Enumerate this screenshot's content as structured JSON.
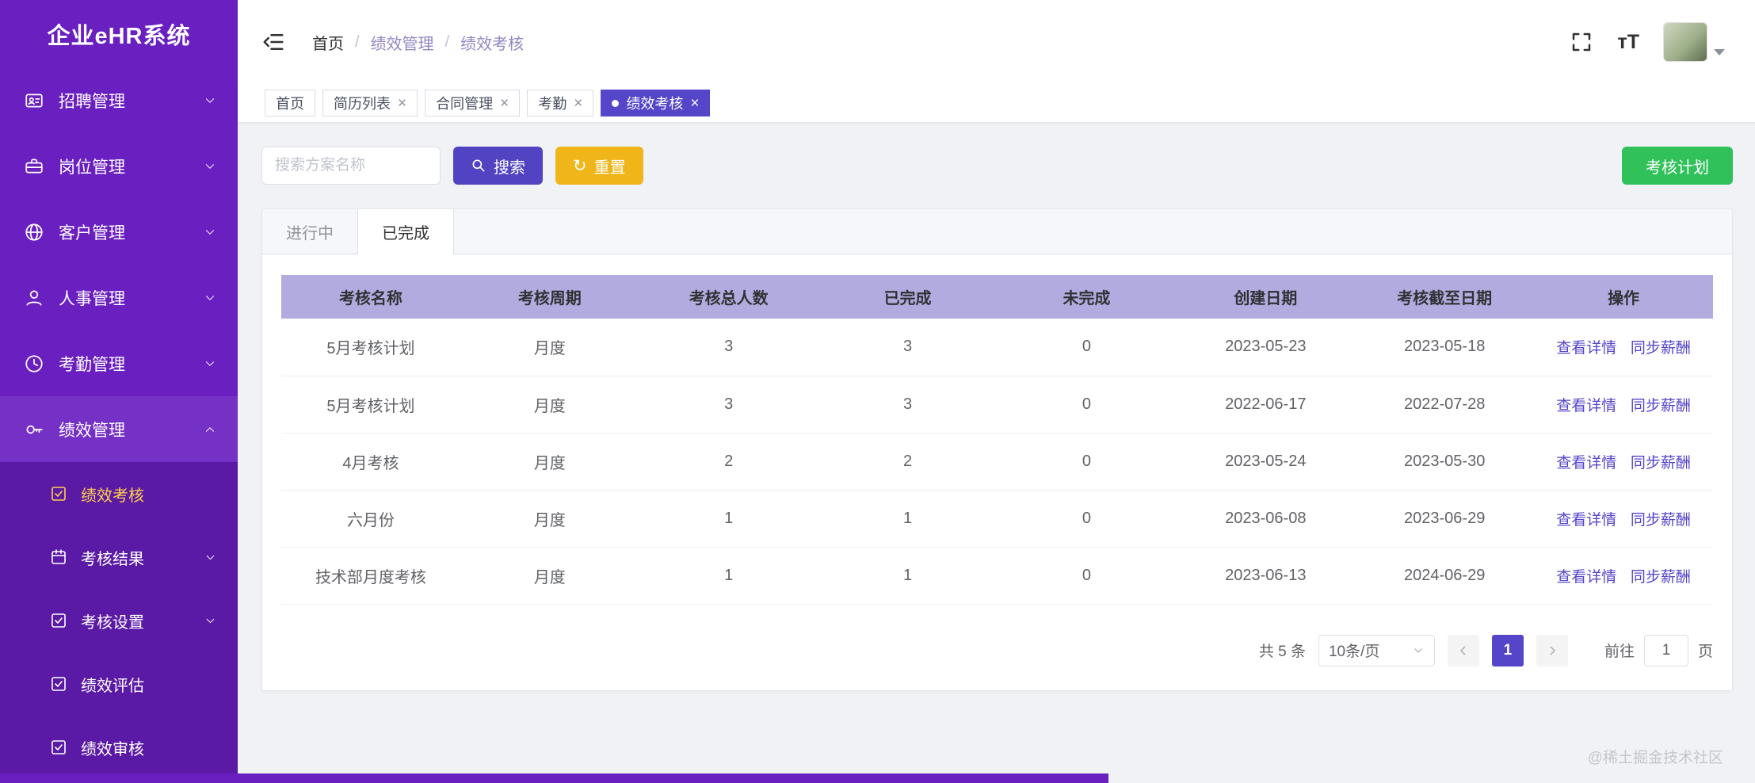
{
  "app": {
    "title": "企业eHR系统"
  },
  "sidebar": {
    "items": [
      {
        "label": "招聘管理"
      },
      {
        "label": "岗位管理"
      },
      {
        "label": "客户管理"
      },
      {
        "label": "人事管理"
      },
      {
        "label": "考勤管理"
      },
      {
        "label": "绩效管理"
      }
    ],
    "submenu": [
      {
        "label": "绩效考核"
      },
      {
        "label": "考核结果"
      },
      {
        "label": "考核设置"
      },
      {
        "label": "绩效评估"
      },
      {
        "label": "绩效审核"
      }
    ]
  },
  "breadcrumb": {
    "items": [
      "首页",
      "绩效管理",
      "绩效考核"
    ],
    "separator": "/"
  },
  "tags": [
    {
      "label": "首页"
    },
    {
      "label": "简历列表"
    },
    {
      "label": "合同管理"
    },
    {
      "label": "考勤"
    },
    {
      "label": "绩效考核"
    }
  ],
  "toolbar": {
    "search_placeholder": "搜索方案名称",
    "search_button": "搜索",
    "reset_button": "重置",
    "plan_button": "考核计划"
  },
  "tabs": {
    "in_progress": "进行中",
    "completed": "已完成"
  },
  "table": {
    "headers": [
      "考核名称",
      "考核周期",
      "考核总人数",
      "已完成",
      "未完成",
      "创建日期",
      "考核截至日期",
      "操作"
    ],
    "rows": [
      {
        "name": "5月考核计划",
        "cycle": "月度",
        "total": "3",
        "done": "3",
        "undone": "0",
        "created": "2023-05-23",
        "deadline": "2023-05-18"
      },
      {
        "name": "5月考核计划",
        "cycle": "月度",
        "total": "3",
        "done": "3",
        "undone": "0",
        "created": "2022-06-17",
        "deadline": "2022-07-28"
      },
      {
        "name": "4月考核",
        "cycle": "月度",
        "total": "2",
        "done": "2",
        "undone": "0",
        "created": "2023-05-24",
        "deadline": "2023-05-30"
      },
      {
        "name": "六月份",
        "cycle": "月度",
        "total": "1",
        "done": "1",
        "undone": "0",
        "created": "2023-06-08",
        "deadline": "2023-06-29"
      },
      {
        "name": "技术部月度考核",
        "cycle": "月度",
        "total": "1",
        "done": "1",
        "undone": "0",
        "created": "2023-06-13",
        "deadline": "2024-06-29"
      }
    ],
    "actions": {
      "view": "查看详情",
      "sync": "同步薪酬"
    }
  },
  "pagination": {
    "total": "共 5 条",
    "page_size": "10条/页",
    "page": "1",
    "goto": "前往",
    "goto_value": "1",
    "unit": "页"
  },
  "icons": {
    "close": "×",
    "font_size": "тT",
    "refresh": "↻"
  },
  "colors": {
    "sidebar_purple": "#6a1fc0",
    "accent_purple": "#5546c9",
    "reset_yellow": "#f0b519",
    "plan_green": "#30c15b",
    "table_header_bg": "#b1abdf",
    "active_menu_text": "#ffd04b"
  },
  "footer": {
    "watermark": "@稀土掘金技术社区"
  }
}
